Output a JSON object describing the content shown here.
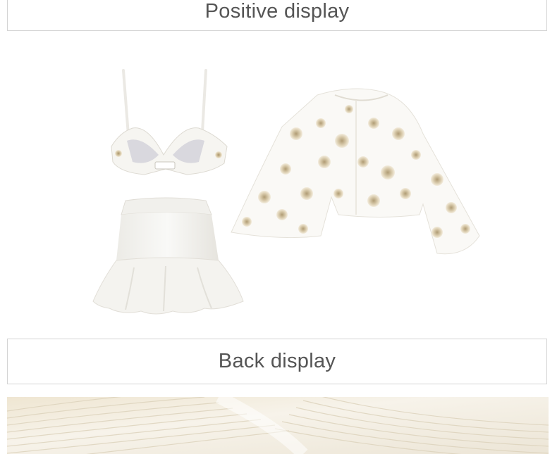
{
  "sections": {
    "positive_display": {
      "label": "Positive display"
    },
    "back_display": {
      "label": "Back display"
    }
  },
  "product_image": {
    "items": [
      "bikini-top",
      "ruffle-skirt",
      "floral-lace-cover-up"
    ],
    "colors": {
      "garment_white": "#f7f6f3",
      "garment_shadow": "#e6e3dc",
      "floral_beige": "#d8c9a8",
      "floral_brown": "#a89266"
    }
  },
  "detail_image": {
    "subject": "ribbed-knit-fabric-closeup",
    "colors": {
      "fabric_cream": "#f3ede0",
      "fabric_stripe": "#ddd3bc"
    }
  }
}
